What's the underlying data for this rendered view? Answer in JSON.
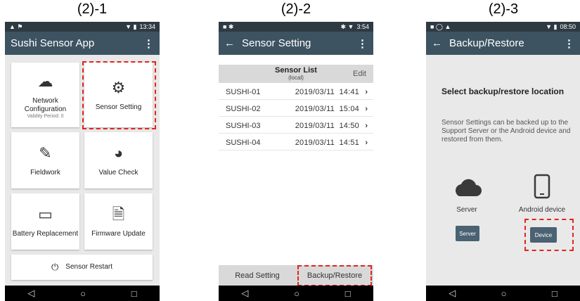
{
  "captions": [
    "(2)-1",
    "(2)-2",
    "(2)-3"
  ],
  "phone1": {
    "status_time": "13:34",
    "app_title": "Sushi Sensor App",
    "menu_icon": "more-vert-icon",
    "tiles": {
      "network": {
        "label": "Network Configuration",
        "sub": "Validity Period: 0",
        "icon": "cloud-network-icon"
      },
      "sensor_setting": {
        "label": "Sensor Setting",
        "icon": "gear-icon"
      },
      "fieldwork": {
        "label": "Fieldwork",
        "icon": "clipboard-pen-icon"
      },
      "value_check": {
        "label": "Value Check",
        "icon": "gauge-icon"
      },
      "battery": {
        "label": "Battery Replacement",
        "icon": "battery-icon"
      },
      "firmware": {
        "label": "Firmware Update",
        "icon": "file-gear-icon"
      },
      "restart": {
        "label": "Sensor Restart",
        "icon": "power-icon"
      }
    }
  },
  "phone2": {
    "status_time": "3:54",
    "title": "Sensor Setting",
    "list_title": "Sensor List",
    "list_sub": "(local)",
    "edit_label": "Edit",
    "rows": [
      {
        "name": "SUSHI-01",
        "date": "2019/03/11",
        "time": "14:41"
      },
      {
        "name": "SUSHI-02",
        "date": "2019/03/11",
        "time": "15:04"
      },
      {
        "name": "SUSHI-03",
        "date": "2019/03/11",
        "time": "14:50"
      },
      {
        "name": "SUSHI-04",
        "date": "2019/03/11",
        "time": "14:51"
      }
    ],
    "read_setting": "Read Setting",
    "backup_restore": "Backup/Restore"
  },
  "phone3": {
    "status_time": "08:50",
    "title": "Backup/Restore",
    "heading": "Select backup/restore location",
    "description": "Sensor Settings can be backed up to the Support Server or the Android device and restored from them.",
    "server_caption": "Server",
    "device_caption": "Android device",
    "server_button": "Server",
    "device_button": "Device"
  },
  "colors": {
    "appbar": "#3d5361",
    "highlight": "#e0261f",
    "button": "#4a6272"
  }
}
